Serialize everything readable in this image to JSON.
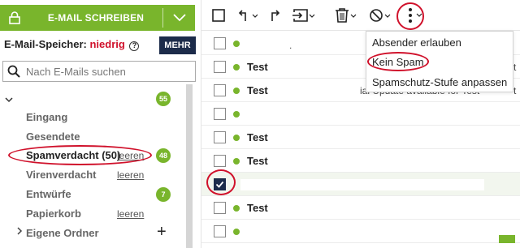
{
  "sidebar": {
    "compose_label": "E-MAIL SCHREIBEN",
    "storage_label": "E-Mail-Speicher:",
    "storage_level": "niedrig",
    "info_glyph": "?",
    "more_label": "MEHR",
    "search_placeholder": "Nach E-Mails suchen",
    "main_badge": "55",
    "folders": [
      {
        "label": "Eingang"
      },
      {
        "label": "Gesendete"
      },
      {
        "label": "Spamverdacht (50)",
        "action": "leeren",
        "badge": "48"
      },
      {
        "label": "Virenverdacht",
        "action": "leeren"
      },
      {
        "label": "Entwürfe",
        "badge": "7"
      },
      {
        "label": "Papierkorb",
        "action": "leeren"
      },
      {
        "label": "Eigene Ordner"
      }
    ]
  },
  "toolbar": {
    "icons": [
      "checkbox-icon",
      "reply-icon",
      "forward-icon",
      "move-icon",
      "trash-icon",
      "block-icon",
      "more-vertical-icon"
    ]
  },
  "menu": {
    "items": [
      "Absender erlauben",
      "Kein Spam",
      "Spamschutz-Stufe anpassen"
    ]
  },
  "messages": [
    {
      "subject": ""
    },
    {
      "subject": "Test"
    },
    {
      "subject": "Test"
    },
    {
      "subject": ""
    },
    {
      "subject": "Test"
    },
    {
      "subject": "Test"
    },
    {
      "subject": ""
    },
    {
      "subject": "Test"
    },
    {
      "subject": ""
    }
  ],
  "background_text": {
    "row2_tail": "t",
    "row3_tail": "ial Update available for Test",
    "row3_end": "t",
    "row1_mark": "."
  },
  "colors": {
    "accent": "#79b52c",
    "navy": "#1c2b4a",
    "alert": "#d0112b"
  }
}
